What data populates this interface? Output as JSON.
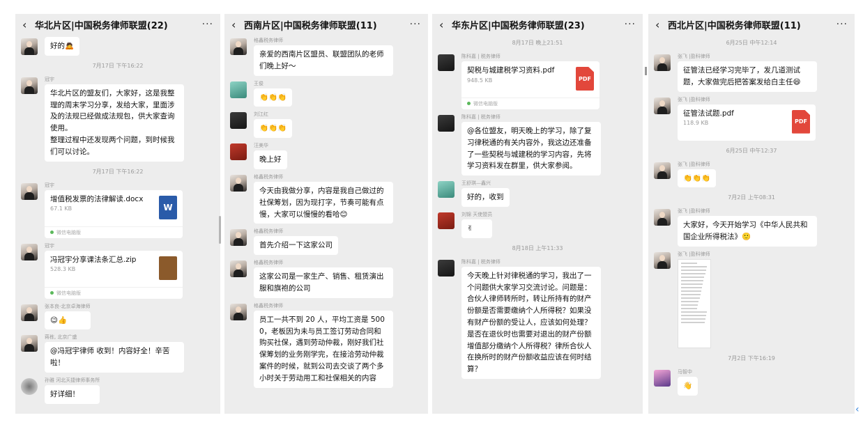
{
  "panels": [
    {
      "title": "华北片区|中国税务律师联盟(22)",
      "items": [
        {
          "kind": "msg",
          "sender": "",
          "text": "好的🙇",
          "avatar": "default"
        },
        {
          "kind": "ts",
          "text": "7月17日 下午16:22"
        },
        {
          "kind": "msg",
          "sender": "冠宇",
          "text": "华北片区的盟友们，大家好，这是我整理的周末学习分享，发给大家，里面涉及的法规已经做成法规包，供大家查询使用。\n整理过程中还发现两个问题，到时候我们可以讨论。",
          "avatar": "default"
        },
        {
          "kind": "ts",
          "text": "7月17日 下午16:22"
        },
        {
          "kind": "file",
          "sender": "冠宇",
          "name": "增值税发票的法律解读.docx",
          "size": "67.1 KB",
          "icon": "W",
          "icon_type": "word",
          "foot": "微信电脑版",
          "avatar": "default"
        },
        {
          "kind": "file",
          "sender": "冠宇",
          "name": "冯冠宇分享课法条汇总.zip",
          "size": "528.3 KB",
          "icon": "",
          "icon_type": "zip",
          "foot": "微信电脑版",
          "avatar": "default"
        },
        {
          "kind": "msg",
          "sender": "张本良-北京卓海律师",
          "text": "😉👍",
          "avatar": "default"
        },
        {
          "kind": "msg",
          "sender": "蒋栋, 北京广盛",
          "text": "@冯冠宇律师 收到！内容好全！辛苦啦！",
          "avatar": "default"
        },
        {
          "kind": "msg",
          "sender": "孙雅 河北天捷律师事务所",
          "text": "好详细！",
          "avatar": "grey"
        }
      ]
    },
    {
      "title": "西南片区|中国税务律师联盟(11)",
      "items": [
        {
          "kind": "msg",
          "sender": "格鑫税务律师",
          "text": "亲爱的西南片区盟员、联盟团队的老师们晚上好～",
          "avatar": "default"
        },
        {
          "kind": "msg",
          "sender": "王俊",
          "text": "👏👏👏",
          "avatar": "teal"
        },
        {
          "kind": "msg",
          "sender": "刘江红",
          "text": "👏👏👏",
          "avatar": "dark"
        },
        {
          "kind": "msg",
          "sender": "汪美华",
          "text": "晚上好",
          "avatar": "red"
        },
        {
          "kind": "msg",
          "sender": "格鑫税务律师",
          "text": "今天由我做分享，内容是我自己做过的社保筹划，因为现打字，节奏可能有点慢，大家可以慢慢的看哈😊",
          "avatar": "default"
        },
        {
          "kind": "msg",
          "sender": "格鑫税务律师",
          "text": "首先介绍一下这家公司",
          "avatar": "default"
        },
        {
          "kind": "msg",
          "sender": "格鑫税务律师",
          "text": "这家公司是一家生产、销售、租赁演出服和旗袍的公司",
          "avatar": "default"
        },
        {
          "kind": "msg",
          "sender": "格鑫税务律师",
          "text": "员工一共不到 20 人，平均工资是 5000，老板因为未与员工签订劳动合同和购买社保，遇到劳动仲裁，刚好我们社保筹划的业务刚学完，在接洽劳动仲裁案件的时候，就到公司去交谈了两个多小时关于劳动用工和社保相关的内容",
          "avatar": "default"
        }
      ]
    },
    {
      "title": "华东片区|中国税务律师联盟(23)",
      "items": [
        {
          "kind": "ts",
          "text": "8月17日 晚上21:51"
        },
        {
          "kind": "file",
          "sender": "陈科嘉 | 税务律师",
          "name": "契税与城建税学习资料.pdf",
          "size": "948.5 KB",
          "icon": "PDF",
          "icon_type": "pdf",
          "foot": "微信电脑版",
          "avatar": "dark"
        },
        {
          "kind": "msg",
          "sender": "陈科嘉 | 税务律师",
          "text": "@各位盟友，明天晚上的学习，除了复习律税通的有关内容外，我这边还准备了一些契税与城建税的学习内容，先将学习资料发在群里，供大家参阅。",
          "avatar": "dark"
        },
        {
          "kind": "msg",
          "sender": "王舒琪—鑫兴",
          "text": "好的，收到",
          "avatar": "teal"
        },
        {
          "kind": "msg",
          "sender": "刘锦 天使盟员",
          "text": "✌",
          "avatar": "red"
        },
        {
          "kind": "ts",
          "text": "8月18日 上午11:33"
        },
        {
          "kind": "msg",
          "sender": "陈科嘉 | 税务律师",
          "text": "今天晚上针对律税通的学习，我出了一个问题供大家学习交流讨论。问题是：合伙人律师转所时，转让所持有的财产份额是否需要缴纳个人所得税？如果没有财产份额的受让人，应该如何处理？是否在退伙时也需要对退出的财产份额增值部分缴纳个人所得税？律所合伙人在换所时的财产份额收益应该在何时结算？",
          "avatar": "dark"
        }
      ]
    },
    {
      "title": "西北片区|中国税务律师联盟(11)",
      "items": [
        {
          "kind": "ts",
          "text": "6月25日 中午12:14"
        },
        {
          "kind": "msg",
          "sender": "张飞 |盈科律师",
          "text": "征管法已经学习完毕了，发几道测试题，大家做完后把答案发给白主任😄",
          "avatar": "default"
        },
        {
          "kind": "file",
          "sender": "张飞 |盈科律师",
          "name": "征管法试题.pdf",
          "size": "118.9 KB",
          "icon": "PDF",
          "icon_type": "pdf",
          "foot": "",
          "avatar": "default"
        },
        {
          "kind": "ts",
          "text": "6月25日 中午12:37"
        },
        {
          "kind": "msg",
          "sender": "张飞 |盈科律师",
          "text": "👏👏👏",
          "avatar": "default"
        },
        {
          "kind": "ts",
          "text": "7月2日 上午08:31"
        },
        {
          "kind": "msg",
          "sender": "张飞 |盈科律师",
          "text": "大家好，今天开始学习《中华人民共和国企业所得税法》🙂",
          "avatar": "default"
        },
        {
          "kind": "img",
          "sender": "张飞 |盈科律师",
          "avatar": "default"
        },
        {
          "kind": "ts",
          "text": "7月2日 下午16:19"
        },
        {
          "kind": "msg",
          "sender": "马智中",
          "text": "👋",
          "avatar": "purple"
        }
      ]
    }
  ],
  "icons": {
    "back": "chevron-left-icon",
    "more": "more-dots-icon"
  },
  "colors": {
    "panel_bg": "#ededed",
    "bubble": "#ffffff",
    "pdf": "#e2473b",
    "word": "#2a5ba9"
  }
}
